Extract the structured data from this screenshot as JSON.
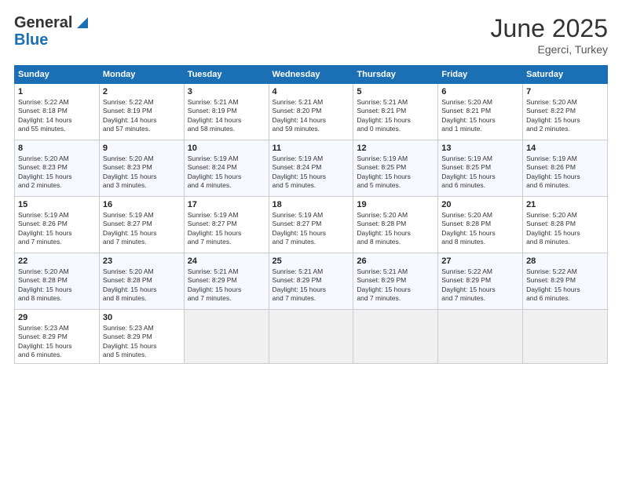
{
  "header": {
    "logo_general": "General",
    "logo_blue": "Blue",
    "month_title": "June 2025",
    "location": "Egerci, Turkey"
  },
  "days_of_week": [
    "Sunday",
    "Monday",
    "Tuesday",
    "Wednesday",
    "Thursday",
    "Friday",
    "Saturday"
  ],
  "weeks": [
    [
      {
        "day": "1",
        "info": "Sunrise: 5:22 AM\nSunset: 8:18 PM\nDaylight: 14 hours\nand 55 minutes."
      },
      {
        "day": "2",
        "info": "Sunrise: 5:22 AM\nSunset: 8:19 PM\nDaylight: 14 hours\nand 57 minutes."
      },
      {
        "day": "3",
        "info": "Sunrise: 5:21 AM\nSunset: 8:19 PM\nDaylight: 14 hours\nand 58 minutes."
      },
      {
        "day": "4",
        "info": "Sunrise: 5:21 AM\nSunset: 8:20 PM\nDaylight: 14 hours\nand 59 minutes."
      },
      {
        "day": "5",
        "info": "Sunrise: 5:21 AM\nSunset: 8:21 PM\nDaylight: 15 hours\nand 0 minutes."
      },
      {
        "day": "6",
        "info": "Sunrise: 5:20 AM\nSunset: 8:21 PM\nDaylight: 15 hours\nand 1 minute."
      },
      {
        "day": "7",
        "info": "Sunrise: 5:20 AM\nSunset: 8:22 PM\nDaylight: 15 hours\nand 2 minutes."
      }
    ],
    [
      {
        "day": "8",
        "info": "Sunrise: 5:20 AM\nSunset: 8:23 PM\nDaylight: 15 hours\nand 2 minutes."
      },
      {
        "day": "9",
        "info": "Sunrise: 5:20 AM\nSunset: 8:23 PM\nDaylight: 15 hours\nand 3 minutes."
      },
      {
        "day": "10",
        "info": "Sunrise: 5:19 AM\nSunset: 8:24 PM\nDaylight: 15 hours\nand 4 minutes."
      },
      {
        "day": "11",
        "info": "Sunrise: 5:19 AM\nSunset: 8:24 PM\nDaylight: 15 hours\nand 5 minutes."
      },
      {
        "day": "12",
        "info": "Sunrise: 5:19 AM\nSunset: 8:25 PM\nDaylight: 15 hours\nand 5 minutes."
      },
      {
        "day": "13",
        "info": "Sunrise: 5:19 AM\nSunset: 8:25 PM\nDaylight: 15 hours\nand 6 minutes."
      },
      {
        "day": "14",
        "info": "Sunrise: 5:19 AM\nSunset: 8:26 PM\nDaylight: 15 hours\nand 6 minutes."
      }
    ],
    [
      {
        "day": "15",
        "info": "Sunrise: 5:19 AM\nSunset: 8:26 PM\nDaylight: 15 hours\nand 7 minutes."
      },
      {
        "day": "16",
        "info": "Sunrise: 5:19 AM\nSunset: 8:27 PM\nDaylight: 15 hours\nand 7 minutes."
      },
      {
        "day": "17",
        "info": "Sunrise: 5:19 AM\nSunset: 8:27 PM\nDaylight: 15 hours\nand 7 minutes."
      },
      {
        "day": "18",
        "info": "Sunrise: 5:19 AM\nSunset: 8:27 PM\nDaylight: 15 hours\nand 7 minutes."
      },
      {
        "day": "19",
        "info": "Sunrise: 5:20 AM\nSunset: 8:28 PM\nDaylight: 15 hours\nand 8 minutes."
      },
      {
        "day": "20",
        "info": "Sunrise: 5:20 AM\nSunset: 8:28 PM\nDaylight: 15 hours\nand 8 minutes."
      },
      {
        "day": "21",
        "info": "Sunrise: 5:20 AM\nSunset: 8:28 PM\nDaylight: 15 hours\nand 8 minutes."
      }
    ],
    [
      {
        "day": "22",
        "info": "Sunrise: 5:20 AM\nSunset: 8:28 PM\nDaylight: 15 hours\nand 8 minutes."
      },
      {
        "day": "23",
        "info": "Sunrise: 5:20 AM\nSunset: 8:28 PM\nDaylight: 15 hours\nand 8 minutes."
      },
      {
        "day": "24",
        "info": "Sunrise: 5:21 AM\nSunset: 8:29 PM\nDaylight: 15 hours\nand 7 minutes."
      },
      {
        "day": "25",
        "info": "Sunrise: 5:21 AM\nSunset: 8:29 PM\nDaylight: 15 hours\nand 7 minutes."
      },
      {
        "day": "26",
        "info": "Sunrise: 5:21 AM\nSunset: 8:29 PM\nDaylight: 15 hours\nand 7 minutes."
      },
      {
        "day": "27",
        "info": "Sunrise: 5:22 AM\nSunset: 8:29 PM\nDaylight: 15 hours\nand 7 minutes."
      },
      {
        "day": "28",
        "info": "Sunrise: 5:22 AM\nSunset: 8:29 PM\nDaylight: 15 hours\nand 6 minutes."
      }
    ],
    [
      {
        "day": "29",
        "info": "Sunrise: 5:23 AM\nSunset: 8:29 PM\nDaylight: 15 hours\nand 6 minutes."
      },
      {
        "day": "30",
        "info": "Sunrise: 5:23 AM\nSunset: 8:29 PM\nDaylight: 15 hours\nand 5 minutes."
      },
      {
        "day": "",
        "info": ""
      },
      {
        "day": "",
        "info": ""
      },
      {
        "day": "",
        "info": ""
      },
      {
        "day": "",
        "info": ""
      },
      {
        "day": "",
        "info": ""
      }
    ]
  ]
}
